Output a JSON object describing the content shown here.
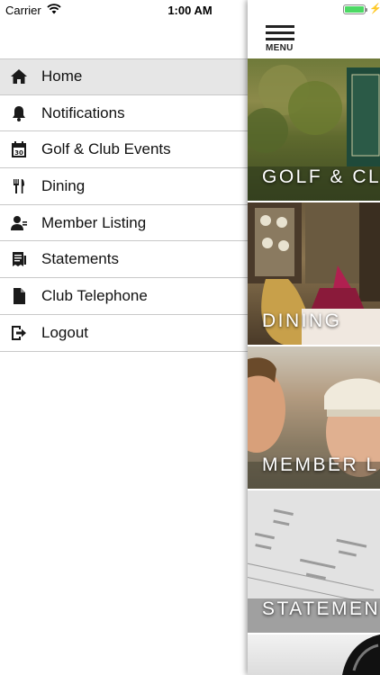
{
  "status_bar": {
    "carrier": "Carrier",
    "time": "1:00 AM",
    "battery_level": 1.0,
    "battery_color": "#4cd964"
  },
  "side_menu": {
    "items": [
      {
        "label": "Home",
        "icon": "home-icon",
        "active": true
      },
      {
        "label": "Notifications",
        "icon": "bell-icon",
        "active": false
      },
      {
        "label": "Golf & Club Events",
        "icon": "calendar-icon",
        "active": false
      },
      {
        "label": "Dining",
        "icon": "fork-knife-icon",
        "active": false
      },
      {
        "label": "Member Listing",
        "icon": "members-icon",
        "active": false
      },
      {
        "label": "Statements",
        "icon": "statement-icon",
        "active": false
      },
      {
        "label": "Club Telephone",
        "icon": "document-icon",
        "active": false
      },
      {
        "label": "Logout",
        "icon": "logout-icon",
        "active": false
      }
    ],
    "active_background": "#e6e6e6"
  },
  "content": {
    "menu_button_label": "MENU",
    "tiles": [
      {
        "title": "GOLF & CLU"
      },
      {
        "title": "DINING"
      },
      {
        "title": "MEMBER L"
      },
      {
        "title": "STATEMEN"
      }
    ]
  }
}
